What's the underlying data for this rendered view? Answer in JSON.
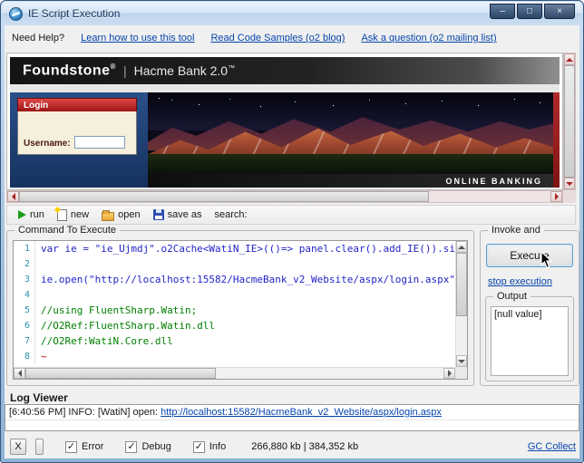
{
  "window": {
    "title": "IE Script Execution",
    "min_glyph": "–",
    "max_glyph": "□",
    "close_glyph": "×"
  },
  "help_bar": {
    "label": "Need Help?",
    "links": [
      {
        "text": "Learn how to use this tool"
      },
      {
        "text": "Read Code Samples (o2 blog)"
      },
      {
        "text": "Ask a question (o2 mailing list)"
      }
    ]
  },
  "browser_page": {
    "brand": "Foundstone",
    "brand_reg": "®",
    "separator": "|",
    "product": "Hacme Bank 2.0",
    "product_tm": "™",
    "login_box": {
      "title": "Login",
      "username_label": "Username:"
    },
    "online_banking": "ONLINE BANKING"
  },
  "toolbar": {
    "run_label": "run",
    "new_label": "new",
    "open_label": "open",
    "save_as_label": "save as",
    "search_label": "search:"
  },
  "command_panel": {
    "title": "Command To Execute",
    "lines": [
      {
        "num": "1",
        "text": "var ie = \"ie_Ujmdj\".o2Cache<WatiN_IE>(()=> panel.clear().add_IE()).si"
      },
      {
        "num": "2",
        "text": ""
      },
      {
        "num": "3",
        "text": "ie.open(\"http://localhost:15582/HacmeBank_v2_Website/aspx/login.aspx\""
      },
      {
        "num": "4",
        "text": ""
      },
      {
        "num": "5",
        "text": "//using FluentSharp.Watin;"
      },
      {
        "num": "6",
        "text": "//O2Ref:FluentSharp.Watin.dll"
      },
      {
        "num": "7",
        "text": "//O2Ref:WatiN.Core.dll"
      },
      {
        "num": "8",
        "text": "~"
      }
    ]
  },
  "invoke_panel": {
    "title": "Invoke and",
    "execute_label": "Execute",
    "stop_link": "stop execution",
    "output_title": "Output",
    "output_value": "[null value]"
  },
  "log_viewer": {
    "title": "Log Viewer",
    "entry_prefix": "[6:40:56 PM] INFO: [WatiN] open: ",
    "entry_link": "http://localhost:15582/HacmeBank_v2_Website/aspx/login.aspx"
  },
  "status_bar": {
    "close_label": "X",
    "checkboxes": [
      {
        "label": "Error",
        "checked": true,
        "mark": "✓"
      },
      {
        "label": "Debug",
        "checked": true,
        "mark": "✓"
      },
      {
        "label": "Info",
        "checked": true,
        "mark": "✓"
      }
    ],
    "memory": "266,880 kb | 384,352 kb",
    "gc_link": "GC Collect"
  },
  "colors": {
    "link": "#0645ad",
    "code": "#2323c8",
    "comment": "#008000",
    "line_number": "#2b91af",
    "banner_red": "#9c1414",
    "scroll_arrow_red": "#a82222"
  }
}
